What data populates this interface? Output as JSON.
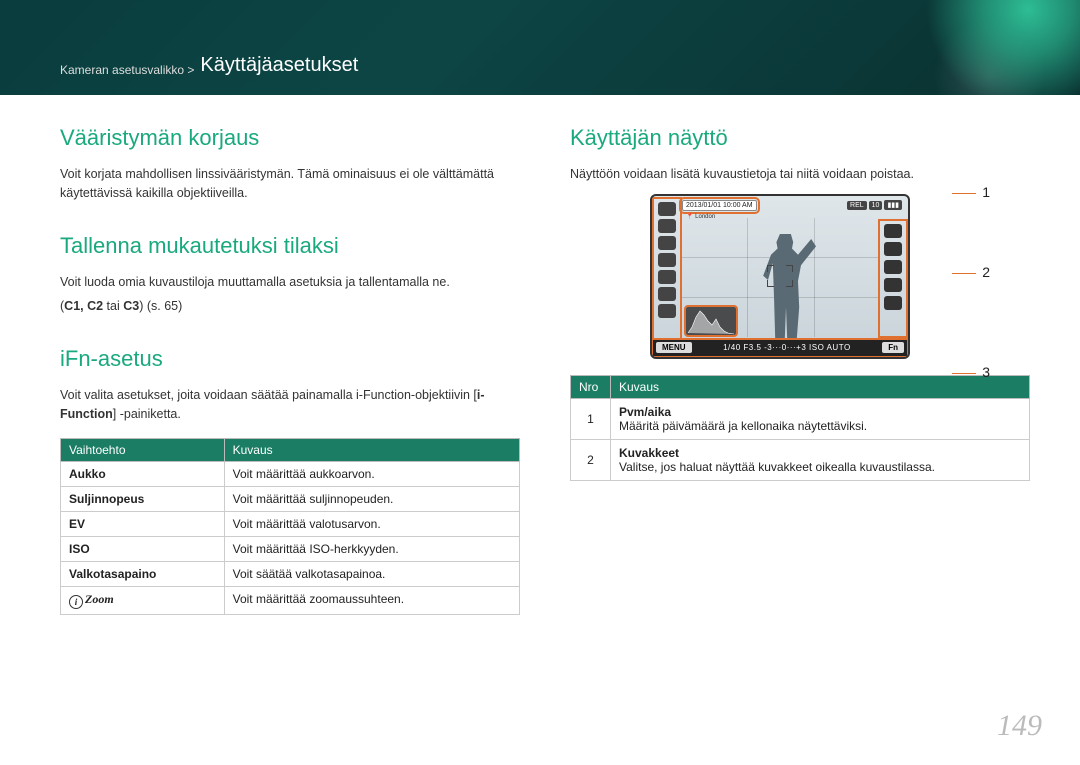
{
  "header": {
    "breadcrumb_prefix": "Kameran asetusvalikko >",
    "title": "Käyttäjäasetukset"
  },
  "left": {
    "sec1_title": "Vääristymän korjaus",
    "sec1_body": "Voit korjata mahdollisen linssivääristymän. Tämä ominaisuus ei ole välttämättä käytettävissä kaikilla objektiiveilla.",
    "sec2_title": "Tallenna mukautetuksi tilaksi",
    "sec2_body1": "Voit luoda omia kuvaustiloja muuttamalla asetuksia ja tallentamalla ne.",
    "sec2_body2_prefix": "(",
    "sec2_body2_bold": "C1, C2",
    "sec2_body2_mid": " tai ",
    "sec2_body2_bold2": "C3",
    "sec2_body2_suffix": ") (s. 65)",
    "sec3_title": "iFn-asetus",
    "sec3_body_pre": "Voit valita asetukset, joita voidaan säätää painamalla i-Function-objektiivin [",
    "sec3_body_bold": "i-Function",
    "sec3_body_post": "] -painiketta.",
    "table": {
      "head_opt": "Vaihtoehto",
      "head_desc": "Kuvaus",
      "rows": [
        {
          "opt": "Aukko",
          "desc": "Voit määrittää aukkoarvon."
        },
        {
          "opt": "Suljinnopeus",
          "desc": "Voit määrittää suljinnopeuden."
        },
        {
          "opt": "EV",
          "desc": "Voit määrittää valotusarvon."
        },
        {
          "opt": "ISO",
          "desc": "Voit määrittää ISO-herkkyyden."
        },
        {
          "opt": "Valkotasapaino",
          "desc": "Voit säätää valkotasapainoa."
        },
        {
          "opt_icon": "i",
          "opt_txt": "Zoom",
          "desc": "Voit määrittää zoomaussuhteen."
        }
      ]
    }
  },
  "right": {
    "sec1_title": "Käyttäjän näyttö",
    "sec1_body": "Näyttöön voidaan lisätä kuvaustietoja tai niitä voidaan poistaa.",
    "callouts": {
      "c1": "1",
      "c2": "2",
      "c3": "3"
    },
    "screen": {
      "timestamp": "2013/01/01 10:00 AM",
      "location_icon": "📍",
      "location": "London",
      "top_right_label1": "REL",
      "top_right_label2": "10",
      "menu": "MENU",
      "fn": "Fn",
      "exposure": "1/40  F3.5   -3···0···+3   ISO AUTO"
    },
    "nro_table": {
      "head_num": "Nro",
      "head_desc": "Kuvaus",
      "rows": [
        {
          "n": "1",
          "title": "Pvm/aika",
          "desc": "Määritä päivämäärä ja kellonaika näytettäviksi."
        },
        {
          "n": "2",
          "title": "Kuvakkeet",
          "desc": "Valitse, jos haluat näyttää kuvakkeet oikealla kuvaustilassa."
        }
      ]
    }
  },
  "page_number": "149"
}
